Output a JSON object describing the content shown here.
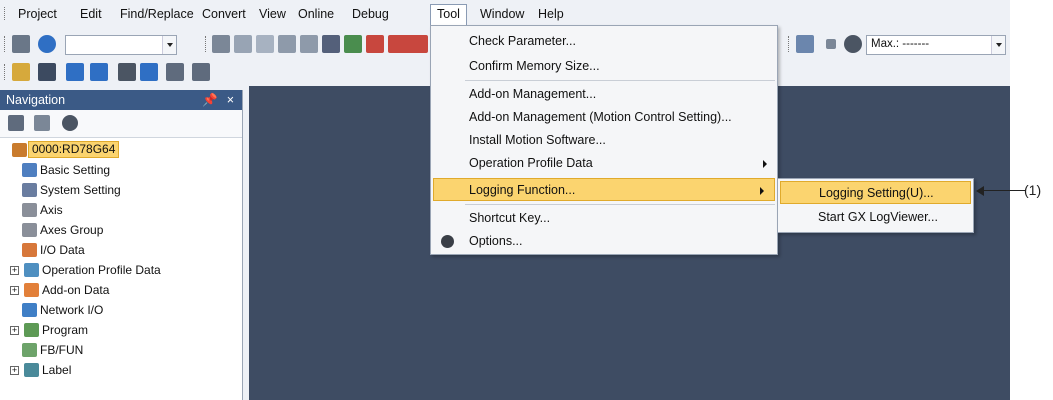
{
  "menubar": {
    "items": [
      {
        "label": "Project"
      },
      {
        "label": "Edit"
      },
      {
        "label": "Find/Replace"
      },
      {
        "label": "Convert"
      },
      {
        "label": "View"
      },
      {
        "label": "Online"
      },
      {
        "label": "Debug"
      },
      {
        "label": "Tool"
      },
      {
        "label": "Window"
      },
      {
        "label": "Help"
      }
    ],
    "active": "Tool"
  },
  "toolbar": {
    "max_label": "Max.: -------"
  },
  "navigation": {
    "title": "Navigation",
    "pin_glyph": "&#x1F4CC;",
    "close_glyph": "×",
    "tree": [
      {
        "label": "0000:RD78G64",
        "selected": true
      },
      {
        "label": "Basic Setting"
      },
      {
        "label": "System Setting"
      },
      {
        "label": "Axis"
      },
      {
        "label": "Axes Group"
      },
      {
        "label": "I/O Data"
      },
      {
        "label": "Operation Profile Data",
        "expandable": true
      },
      {
        "label": "Add-on Data",
        "expandable": true
      },
      {
        "label": "Network I/O"
      },
      {
        "label": "Program",
        "expandable": true
      },
      {
        "label": "FB/FUN"
      },
      {
        "label": "Label",
        "expandable": true
      }
    ]
  },
  "tool_menu": {
    "items": [
      {
        "label": "Check Parameter..."
      },
      {
        "label": "Confirm Memory Size..."
      },
      {
        "label": "Add-on Management..."
      },
      {
        "label": "Add-on Management (Motion Control Setting)..."
      },
      {
        "label": "Install Motion Software..."
      },
      {
        "label": "Operation Profile Data"
      },
      {
        "label": "Logging Function..."
      },
      {
        "label": "Shortcut Key..."
      },
      {
        "label": "Options..."
      }
    ]
  },
  "logging_submenu": {
    "items": [
      {
        "label": "Logging Setting(U)..."
      },
      {
        "label": "Start GX LogViewer..."
      }
    ]
  },
  "callout": {
    "label": "(1)"
  },
  "colors": {
    "highlight": "#fbd46f",
    "nav_header": "#3b5a86",
    "workarea": "#3e4c63"
  }
}
